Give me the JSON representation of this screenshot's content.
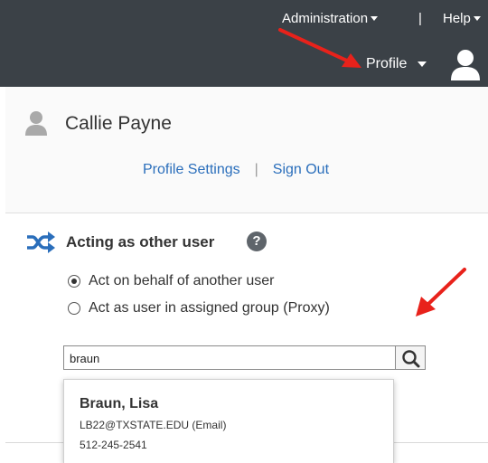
{
  "topbar": {
    "administration_label": "Administration",
    "separator": "|",
    "help_label": "Help",
    "profile_label": "Profile"
  },
  "profile_panel": {
    "user_name": "Callie Payne",
    "profile_settings_label": "Profile Settings",
    "link_separator": "|",
    "sign_out_label": "Sign Out"
  },
  "acting": {
    "title": "Acting as other user",
    "help_glyph": "?",
    "options": [
      {
        "label": "Act on behalf of another user",
        "selected": true
      },
      {
        "label": "Act as user in assigned group (Proxy)",
        "selected": false
      }
    ],
    "search_value": "braun"
  },
  "results": [
    {
      "name": "Braun, Lisa",
      "email": "LB22@TXSTATE.EDU (Email)",
      "phone": "512-245-2541"
    }
  ],
  "colors": {
    "topbar": "#3b4147",
    "link": "#2a6ebb",
    "annotation_arrow": "#e8221b"
  }
}
